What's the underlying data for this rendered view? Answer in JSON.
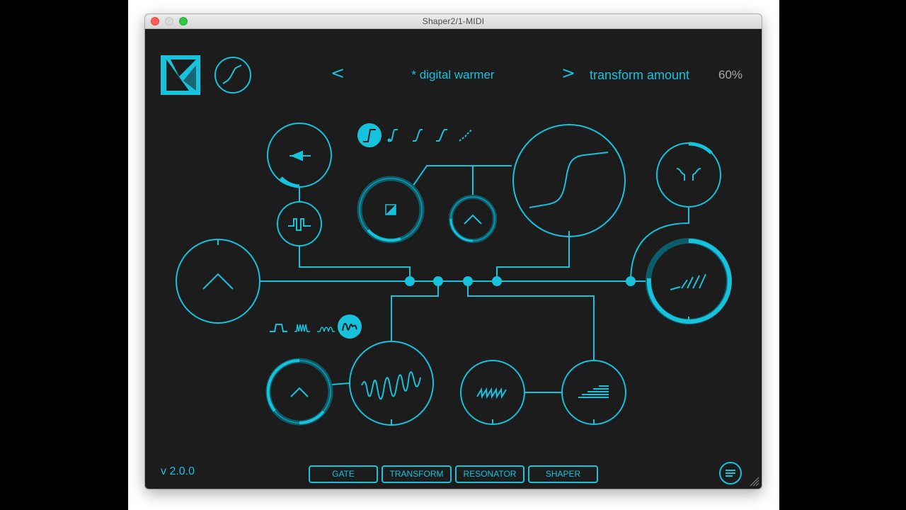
{
  "window": {
    "title": "Shaper2/1-MIDI"
  },
  "header": {
    "logo_icon": "k-logo-icon",
    "mode_icon": "waveshaper-curve-icon",
    "prev_label": "<",
    "preset_name": "* digital warmer",
    "next_label": ">",
    "param_name": "transform amount",
    "param_value": "60%"
  },
  "footer": {
    "version": "v 2.0.0",
    "tabs": [
      {
        "label": "GATE"
      },
      {
        "label": "TRANSFORM"
      },
      {
        "label": "RESONATOR"
      },
      {
        "label": "SHAPER"
      }
    ],
    "menu_icon": "menu-lines-icon"
  },
  "nodes": {
    "shape_selector": [
      "step-curve-1-icon",
      "step-curve-2-icon",
      "step-curve-3-icon",
      "step-curve-4-icon",
      "step-curve-5-icon"
    ],
    "shape_selected_index": 0,
    "lfo_wave_selector": [
      "pulse-wave-icon",
      "burst-wave-icon",
      "sine-burst-wave-icon",
      "random-wave-icon"
    ],
    "lfo_wave_selected_index": 3
  },
  "colors": {
    "accent": "#17c2dc",
    "background": "#1c1c1d",
    "knob_ring": "#0c5d6b",
    "text_muted": "#a9a9a9"
  }
}
